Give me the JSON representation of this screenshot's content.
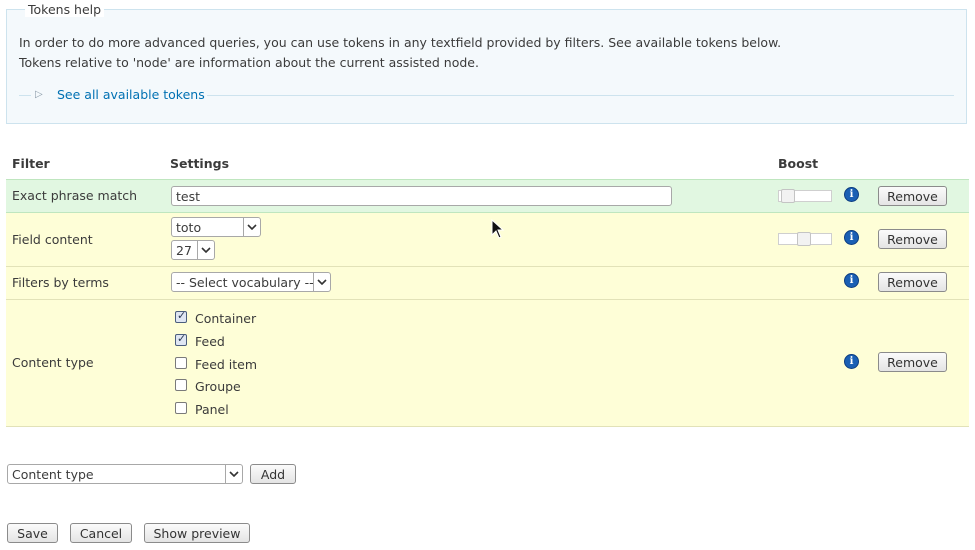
{
  "tokens_help": {
    "legend": "Tokens help",
    "line1": "In order to do more advanced queries, you can use tokens in any textfield provided by filters. See available tokens below.",
    "line2": "Tokens relative to 'node' are information about the current assisted node.",
    "see_all_link": "See all available tokens"
  },
  "table": {
    "headers": {
      "filter": "Filter",
      "settings": "Settings",
      "boost": "Boost"
    },
    "rows": [
      {
        "label": "Exact phrase match",
        "input_value": "test",
        "boost_level": 0.0,
        "remove_label": "Remove"
      },
      {
        "label": "Field content",
        "select1_value": "toto",
        "select2_value": "27",
        "boost_level": 0.45,
        "remove_label": "Remove"
      },
      {
        "label": "Filters by terms",
        "select_value": "-- Select vocabulary --",
        "remove_label": "Remove"
      },
      {
        "label": "Content type",
        "remove_label": "Remove",
        "options": [
          {
            "label": "Container",
            "checked": true
          },
          {
            "label": "Feed",
            "checked": true
          },
          {
            "label": "Feed item",
            "checked": false
          },
          {
            "label": "Groupe",
            "checked": false
          },
          {
            "label": "Panel",
            "checked": false
          }
        ]
      }
    ],
    "info_icon": "info-icon",
    "info_glyph": "i"
  },
  "add_filter": {
    "select_value": "Content type",
    "add_label": "Add"
  },
  "actions": {
    "save": "Save",
    "cancel": "Cancel",
    "preview": "Show preview"
  },
  "colors": {
    "green_row": "#e1f7e1",
    "yellow_row": "#fefed7",
    "link": "#0071b3",
    "info": "#1a5fb4"
  }
}
